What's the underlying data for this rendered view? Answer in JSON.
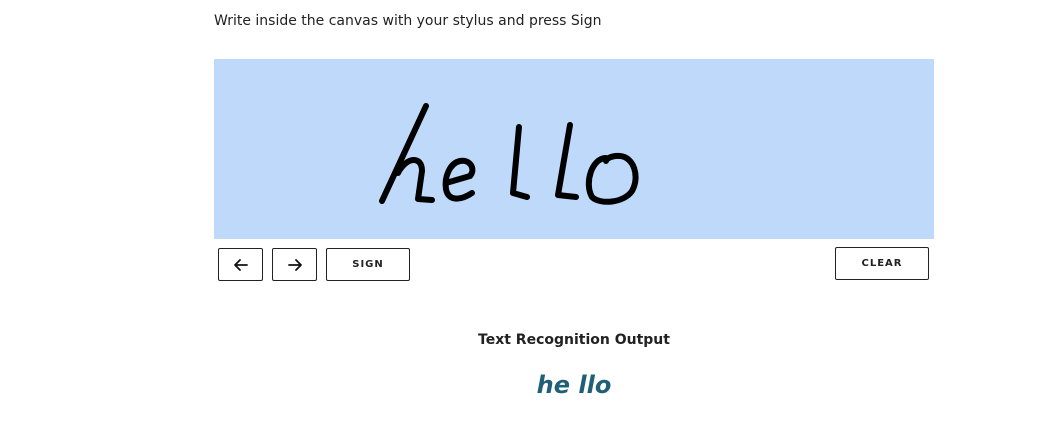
{
  "instructions": "Write inside the canvas with your stylus and press Sign",
  "canvas": {
    "background_color": "#bfd9fb",
    "ink_color": "#000000"
  },
  "buttons": {
    "prev_icon": "arrow-left-icon",
    "next_icon": "arrow-right-icon",
    "sign_label": "SIGN",
    "clear_label": "CLEAR"
  },
  "output": {
    "title": "Text Recognition Output",
    "text": "he llo",
    "text_color": "#1f5f78"
  }
}
